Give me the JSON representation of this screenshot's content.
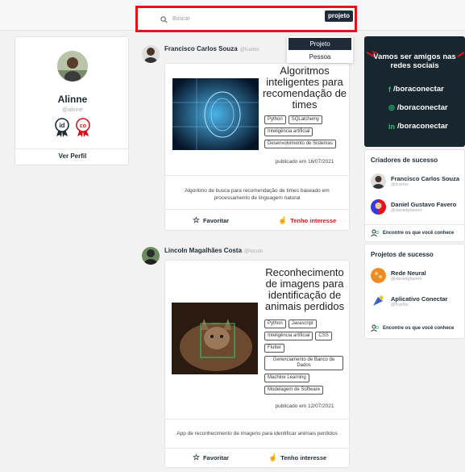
{
  "search": {
    "placeholder": "Buscar",
    "scope": "projeto"
  },
  "dropdown": {
    "options": [
      "Projeto",
      "Pessoa"
    ],
    "selected": "Projeto"
  },
  "profile": {
    "name": "Alinne",
    "handle": "@alinne",
    "view_label": "Ver Perfil",
    "badges": [
      "id-badge",
      "co-badge"
    ]
  },
  "posts": [
    {
      "author": "Francisco Carlos Souza",
      "handle": "@fcarlos",
      "title": "Algoritmos inteligentes para recomendação de times",
      "tags": [
        "Python",
        "SQLalchemy",
        "Inteligência artificial",
        "Desenvolvimento de Sistemas"
      ],
      "published": "publicado em 16/07/2021",
      "description": "Algoritmo de busca para recomendação de times baseado em processamento de linguagem natural",
      "favorite_label": "Favoritar",
      "interest_label": "Tenho interesse"
    },
    {
      "author": "Lincoln Magalhães Costa",
      "handle": "@lincoln",
      "title": "Reconhecimento de imagens para identificação de animais perdidos",
      "tags": [
        "Python",
        "Javascript",
        "Inteligência artificial",
        "CSS",
        "Flutter",
        "Gerenciamento de Banco de Dados",
        "Machine Learning",
        "Modelagem de Software"
      ],
      "published": "publicado em 12/07/2021",
      "description": "App de reconhecimento de imagens para identificar animais perdidos",
      "favorite_label": "Favoritar",
      "interest_label": "Tenho interesse"
    }
  ],
  "social": {
    "heading": "Vamos ser amigos nas redes sociais",
    "items": [
      {
        "icon": "facebook-icon",
        "glyph": "f",
        "label": "/boraconectar"
      },
      {
        "icon": "instagram-icon",
        "glyph": "◎",
        "label": "/boraconectar"
      },
      {
        "icon": "linkedin-icon",
        "glyph": "in",
        "label": "/boraconectar"
      }
    ]
  },
  "creators": {
    "title": "Criadores de sucesso",
    "items": [
      {
        "name": "Francisco Carlos Souza",
        "handle": "@fcarlos"
      },
      {
        "name": "Daniel Gustavo Favero",
        "handle": "@danielgfavero"
      }
    ],
    "link": "Encontre os que você conhece"
  },
  "projects": {
    "title": "Projetos de sucesso",
    "items": [
      {
        "name": "Rede Neural",
        "handle": "@danielgfavero"
      },
      {
        "name": "Aplicativo Conectar",
        "handle": "@fcarlos"
      }
    ],
    "link": "Encontre os que você conhece"
  },
  "colors": {
    "accent": "#e5141a",
    "dark": "#1f2b38",
    "social_bg": "#17262f",
    "social_icon": "#2fc17a"
  }
}
